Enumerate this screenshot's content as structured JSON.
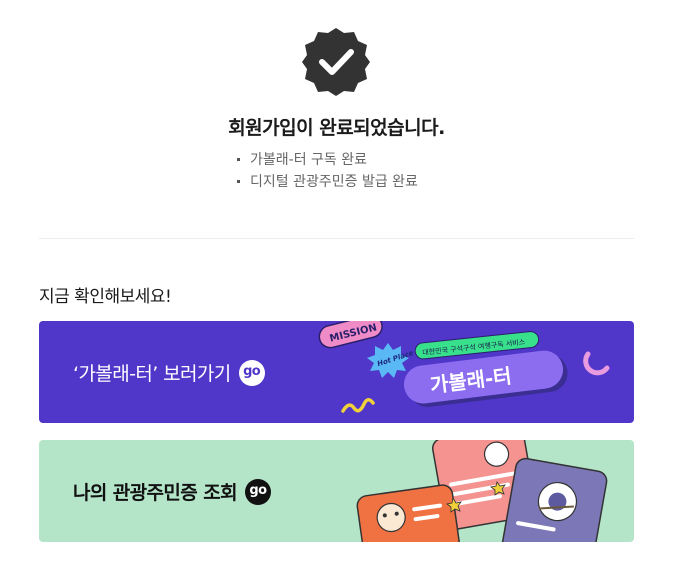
{
  "completion": {
    "badge_icon": "check-badge-icon",
    "title": "회원가입이 완료되었습니다.",
    "items": [
      "가볼래-터 구독 완료",
      "디지털 관광주민증 발급 완료"
    ]
  },
  "section": {
    "title": "지금 확인해보세요!"
  },
  "cards": [
    {
      "label": "‘가볼래-터’ 보러가기",
      "go": "go",
      "color": "#5036c9",
      "art": {
        "mission": "MISSION",
        "hot_place": "Hot Place",
        "tagline": "대한민국 구석구석 여행구독 서비스",
        "logo": "가볼래-터"
      }
    },
    {
      "label": "나의 관광주민증 조회",
      "go": "go",
      "color": "#b4e5c9",
      "art_icon": "resident-id-cards-illustration"
    }
  ]
}
